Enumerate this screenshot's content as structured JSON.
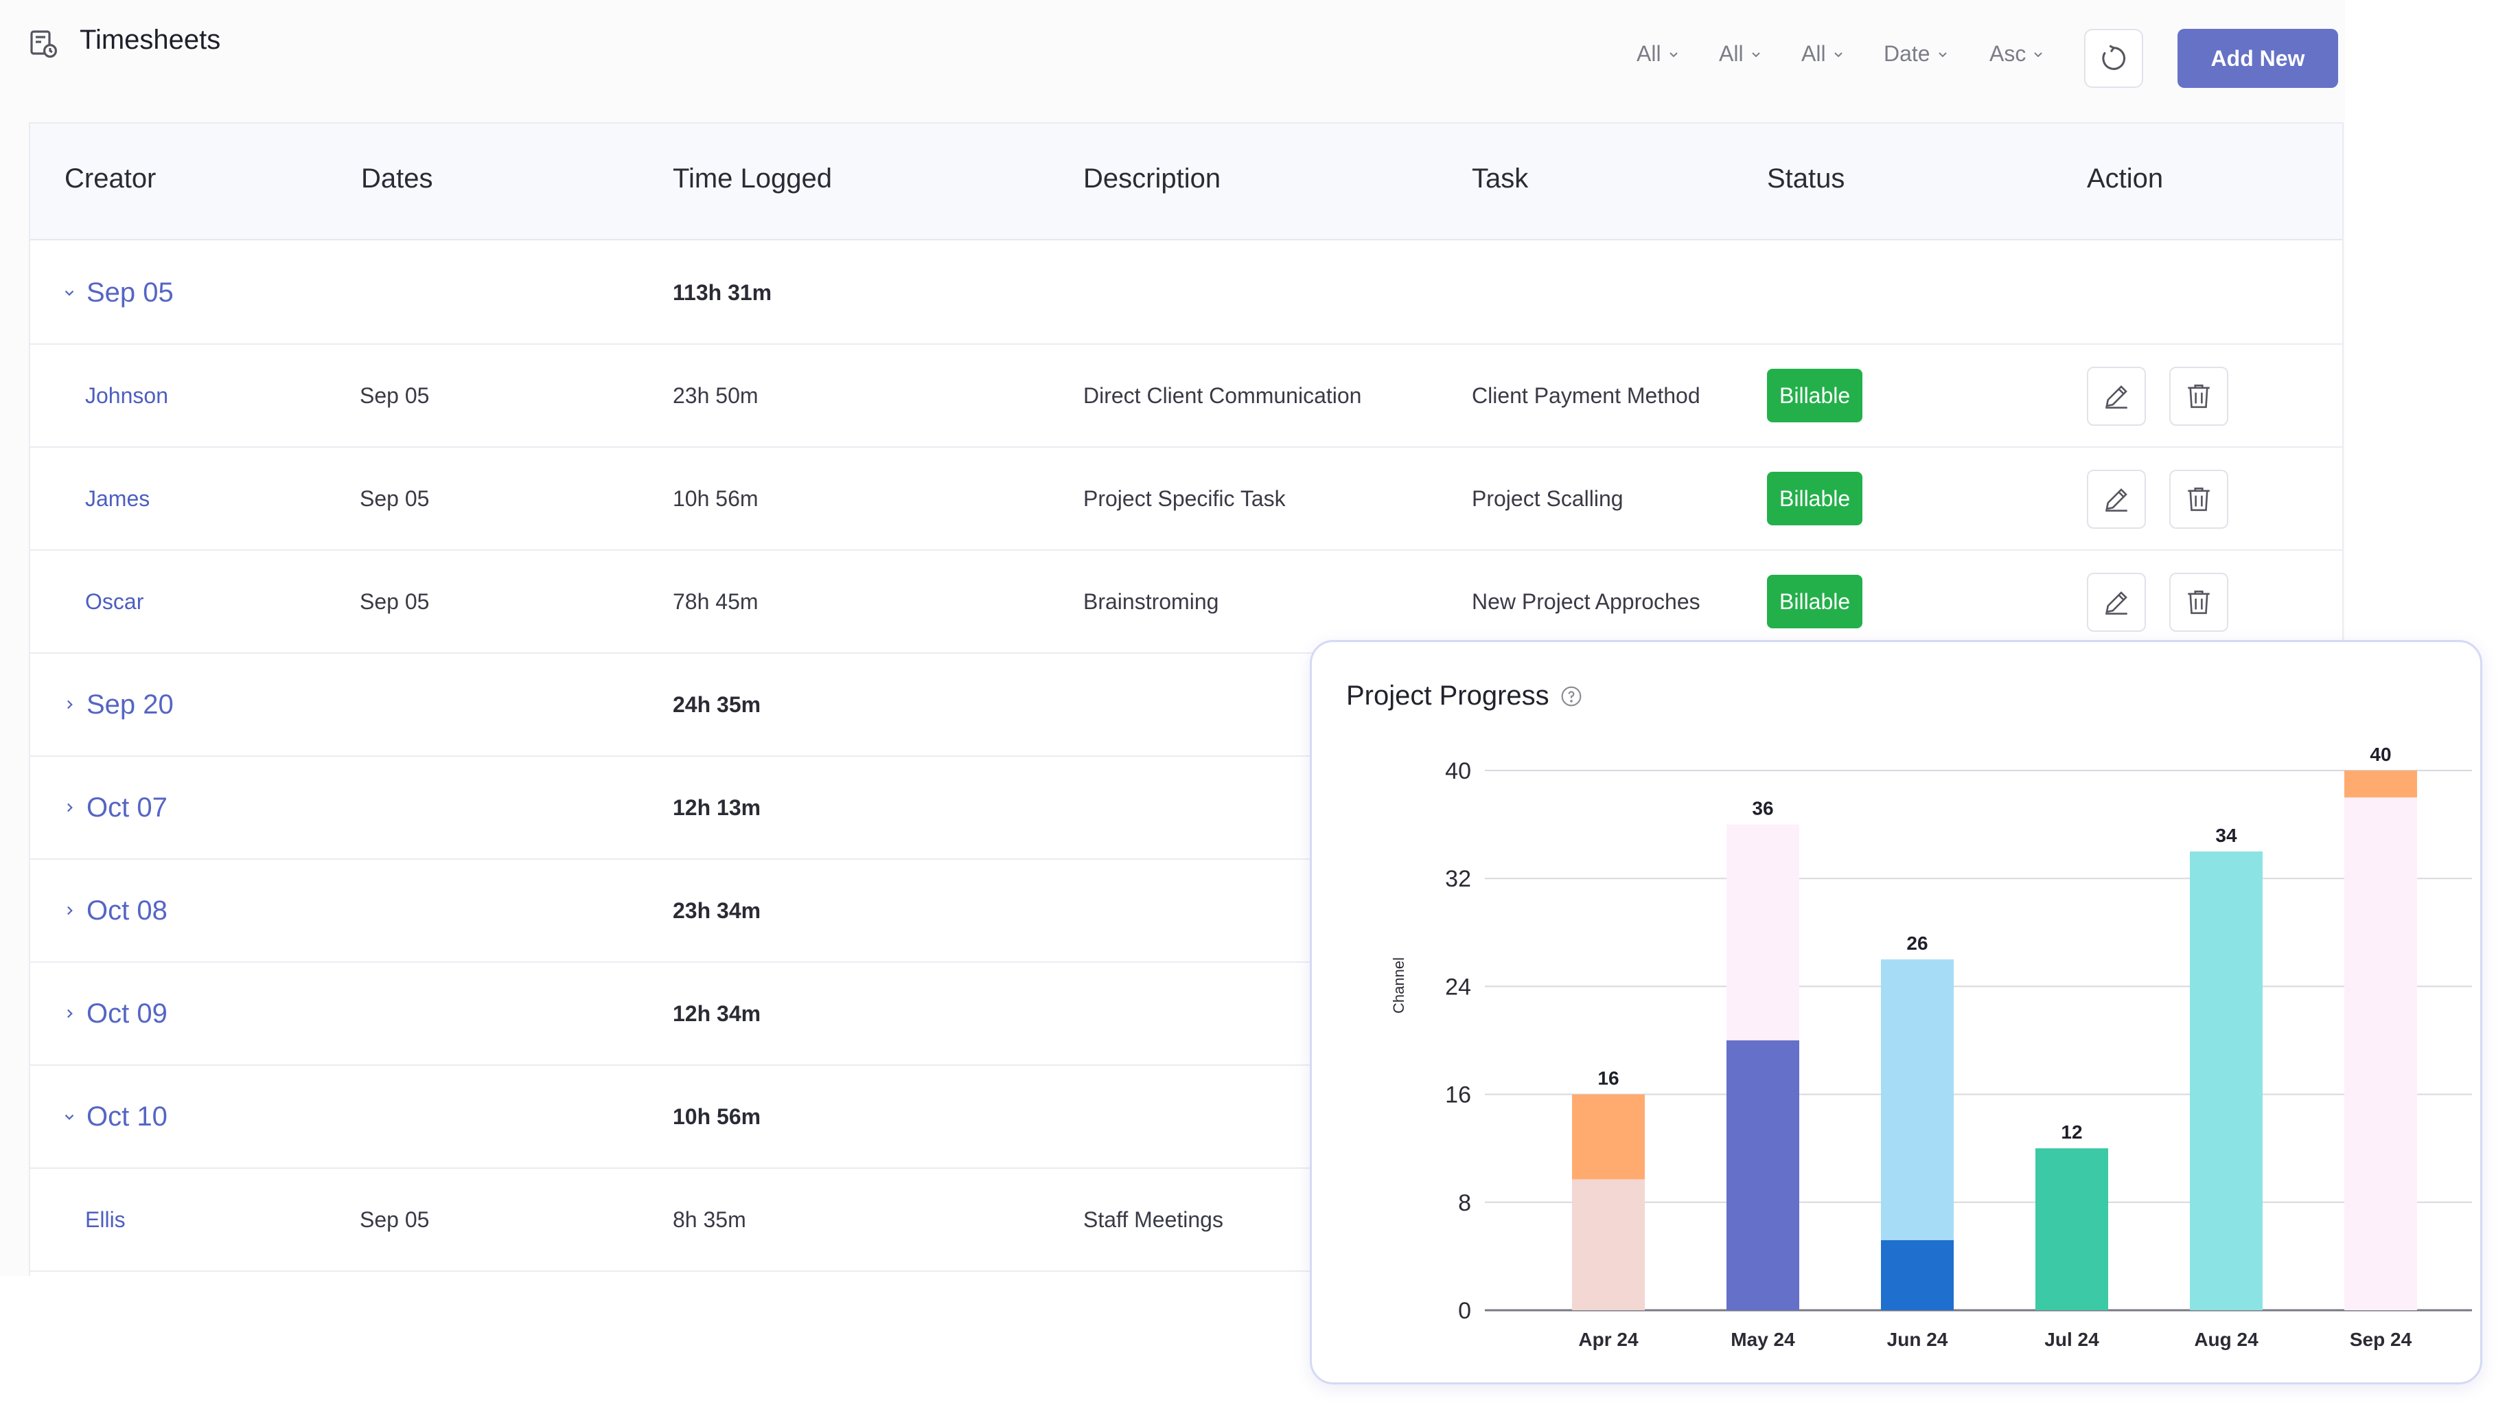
{
  "app": {
    "title": "Timesheets",
    "filters": [
      {
        "label": "All"
      },
      {
        "label": "All"
      },
      {
        "label": "All"
      },
      {
        "label": "Date"
      },
      {
        "label": "Asc"
      }
    ],
    "add_button": "Add New"
  },
  "table": {
    "columns": [
      "Creator",
      "Dates",
      "Time Logged",
      "Description",
      "Task",
      "Status",
      "Action"
    ],
    "rows": [
      {
        "kind": "group",
        "label": "Sep 05",
        "time": "113h 31m",
        "expanded": true
      },
      {
        "kind": "entry",
        "creator": "Johnson",
        "date": "Sep 05",
        "time": "23h 50m",
        "description": "Direct Client Communication",
        "task": "Client Payment Method",
        "status": "Billable"
      },
      {
        "kind": "entry",
        "creator": "James",
        "date": "Sep 05",
        "time": "10h 56m",
        "description": "Project Specific Task",
        "task": "Project Scalling",
        "status": "Billable"
      },
      {
        "kind": "entry",
        "creator": "Oscar",
        "date": "Sep 05",
        "time": "78h 45m",
        "description": "Brainstroming",
        "task": "New Project Approches",
        "status": "Billable"
      },
      {
        "kind": "group",
        "label": "Sep 20",
        "time": "24h 35m",
        "expanded": false
      },
      {
        "kind": "group",
        "label": "Oct 07",
        "time": "12h 13m",
        "expanded": false
      },
      {
        "kind": "group",
        "label": "Oct 08",
        "time": "23h 34m",
        "expanded": false
      },
      {
        "kind": "group",
        "label": "Oct 09",
        "time": "12h 34m",
        "expanded": false
      },
      {
        "kind": "group",
        "label": "Oct 10",
        "time": "10h 56m",
        "expanded": true
      },
      {
        "kind": "entry",
        "creator": "Ellis",
        "date": "Sep 05",
        "time": "8h 35m",
        "description": "Staff Meetings",
        "task": "",
        "status": ""
      }
    ]
  },
  "chart_card": {
    "title": "Project Progress"
  },
  "chart_data": {
    "type": "bar",
    "stacked": true,
    "categories": [
      "Apr 24",
      "May 24",
      "Jun 24",
      "Jul 24",
      "Aug 24",
      "Sep 24"
    ],
    "totals": [
      16,
      36,
      26,
      12,
      34,
      40
    ],
    "segments": [
      [
        {
          "value": 9.7,
          "color": "#f2d7d3"
        },
        {
          "value": 6.3,
          "color": "#ffab70"
        }
      ],
      [
        {
          "value": 20,
          "color": "#6570c8"
        },
        {
          "value": 16,
          "color": "#fdf0fb"
        }
      ],
      [
        {
          "value": 5.2,
          "color": "#1f6fce"
        },
        {
          "value": 20.8,
          "color": "#a7dcf6"
        }
      ],
      [
        {
          "value": 12,
          "color": "#3cc9a5"
        }
      ],
      [
        {
          "value": 34,
          "color": "#8be3e4"
        }
      ],
      [
        {
          "value": 38,
          "color": "#fdf0fb"
        },
        {
          "value": 2,
          "color": "#ffab70"
        }
      ]
    ],
    "ylabel": "Channel",
    "yticks": [
      0,
      8,
      16,
      24,
      32,
      40
    ],
    "ylim": [
      0,
      40
    ],
    "grid": true
  }
}
